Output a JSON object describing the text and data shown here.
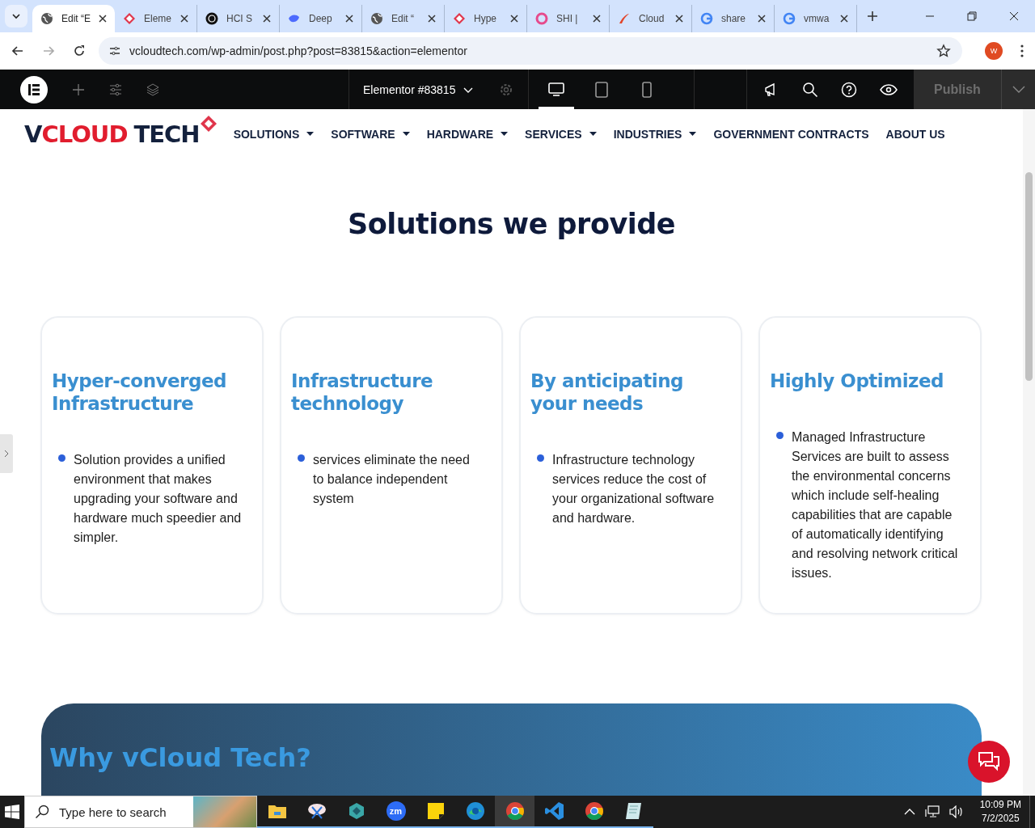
{
  "browser": {
    "tabs": [
      {
        "title": "Edit “E",
        "selected": true,
        "kind": "globe"
      },
      {
        "title": "Eleme",
        "selected": false,
        "kind": "diamond"
      },
      {
        "title": "HCI S",
        "selected": false,
        "kind": "dark"
      },
      {
        "title": "Deep",
        "selected": false,
        "kind": "whale"
      },
      {
        "title": "Edit “",
        "selected": false,
        "kind": "globe"
      },
      {
        "title": "Hype",
        "selected": false,
        "kind": "diamond"
      },
      {
        "title": "SHI |",
        "selected": false,
        "kind": "ring"
      },
      {
        "title": "Cloud",
        "selected": false,
        "kind": "swoosh"
      },
      {
        "title": "share",
        "selected": false,
        "kind": "google"
      },
      {
        "title": "vmwa",
        "selected": false,
        "kind": "google"
      }
    ],
    "url": "vcloudtech.com/wp-admin/post.php?post=83815&action=elementor",
    "profile": "W"
  },
  "editor": {
    "document": "Elementor #83815",
    "devices": [
      {
        "kind": "desktop",
        "selected": true
      },
      {
        "kind": "tablet",
        "selected": false
      },
      {
        "kind": "mobile",
        "selected": false
      }
    ],
    "publish": {
      "label": "Publish",
      "disabled": true
    }
  },
  "site": {
    "logo": {
      "prefix": "V",
      "highlight": "CLOUD",
      "suffix": "TECH"
    },
    "nav": [
      {
        "label": "SOLUTIONS",
        "dropdown": true
      },
      {
        "label": "SOFTWARE",
        "dropdown": true
      },
      {
        "label": "HARDWARE",
        "dropdown": true
      },
      {
        "label": "SERVICES",
        "dropdown": true
      },
      {
        "label": "INDUSTRIES",
        "dropdown": true
      },
      {
        "label": "GOVERNMENT CONTRACTS",
        "dropdown": false
      },
      {
        "label": "ABOUT US",
        "dropdown": false
      }
    ],
    "heading": "Solutions we provide",
    "cards": [
      {
        "title": "Hyper-converged Infrastructure",
        "text": "Solution provides a unified environment that makes upgrading your software and hardware much speedier and simpler."
      },
      {
        "title": "Infrastructure technology",
        "text": "services eliminate the need to balance independent system"
      },
      {
        "title": "By anticipating your needs",
        "text": "Infrastructure technology services reduce the cost of your organizational software and hardware."
      },
      {
        "title": "Highly Optimized",
        "text": "Managed Infrastructure Services are built to assess the environmental concerns which include self-healing capabilities that are capable of automatically identifying and resolving network critical issues."
      }
    ],
    "banner_heading": "Why vCloud Tech?"
  },
  "taskbar": {
    "search_placeholder": "Type here to search",
    "apps": [
      {
        "kind": "folder",
        "selected": false
      },
      {
        "kind": "snip",
        "selected": false
      },
      {
        "kind": "hex",
        "selected": false
      },
      {
        "kind": "zoom",
        "label": "zm",
        "selected": false
      },
      {
        "kind": "note",
        "selected": false
      },
      {
        "kind": "edge",
        "selected": false
      },
      {
        "kind": "chrome",
        "selected": true
      },
      {
        "kind": "code",
        "selected": false
      },
      {
        "kind": "chrome",
        "selected": false
      },
      {
        "kind": "pad",
        "selected": false
      }
    ],
    "time": "10:09 PM",
    "date": "7/2/2025"
  }
}
